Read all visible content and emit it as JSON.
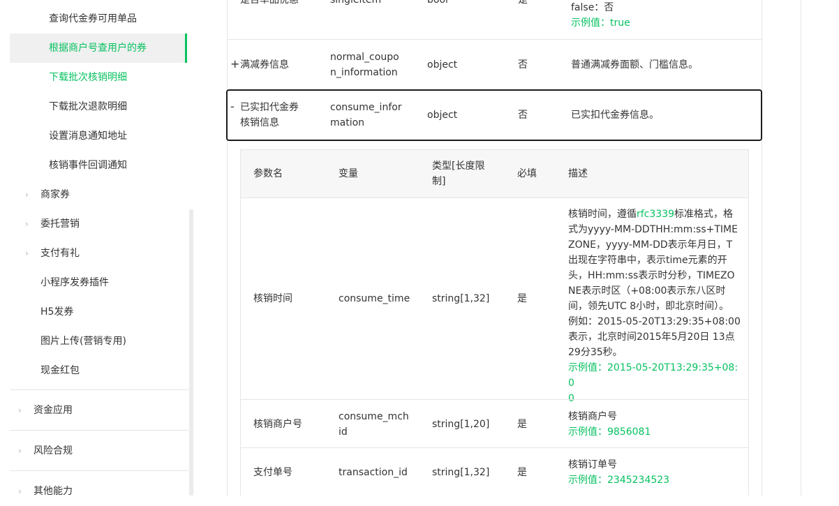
{
  "sidebar": {
    "items": [
      {
        "label": "查询代金券可用单品"
      },
      {
        "label": "根据商户号查用户的券"
      },
      {
        "label": "下载批次核销明细"
      },
      {
        "label": "下载批次退款明细"
      },
      {
        "label": "设置消息通知地址"
      },
      {
        "label": "核销事件回调通知"
      },
      {
        "label": "商家券"
      },
      {
        "label": "委托营销"
      },
      {
        "label": "支付有礼"
      },
      {
        "label": "小程序发券插件"
      },
      {
        "label": "H5发券"
      },
      {
        "label": "图片上传(营销专用)"
      },
      {
        "label": "现金红包"
      },
      {
        "label": "资金应用"
      },
      {
        "label": "风险合规"
      },
      {
        "label": "其他能力"
      }
    ],
    "chevron_icon": "chevron-right-icon"
  },
  "main": {
    "row_top": {
      "name": "是否单品优惠",
      "variable": "singleitem",
      "type": "bool",
      "required": "是",
      "desc_line": "false：否",
      "example": "示例值：true"
    },
    "row_normal": {
      "toggle": "+",
      "name": "满减券信息",
      "variable_l1": "normal_coupo",
      "variable_l2": "n_information",
      "type": "object",
      "required": "否",
      "desc": "普通满减券面额、门槛信息。"
    },
    "row_consume": {
      "toggle": "-",
      "name_l1": "已实扣代金券",
      "name_l2": "核销信息",
      "variable_l1": "consume_infor",
      "variable_l2": "mation",
      "type": "object",
      "required": "否",
      "desc": "已实扣代金券信息。"
    },
    "nested": {
      "headers": {
        "name": "参数名",
        "variable": "变量",
        "type_l1": "类型[长度限",
        "type_l2": "制]",
        "required": "必填",
        "desc": "描述"
      },
      "rows": [
        {
          "name": "核销时间",
          "variable": "consume_time",
          "type": "string[1,32]",
          "required": "是",
          "desc_pre": "核销时间，遵循",
          "desc_link": "rfc3339",
          "desc_l1_post": "标准格式，格",
          "desc_lines": [
            "式为yyyy-MM-DDTHH:mm:ss+TIME",
            "ZONE，yyyy-MM-DD表示年月日，T",
            "出现在字符串中，表示time元素的开",
            "头，HH:mm:ss表示时分秒，TIMEZO",
            "NE表示时区（+08:00表示东八区时",
            "间，领先UTC 8小时，即北京时间）。",
            "例如：2015-05-20T13:29:35+08:00",
            "表示，北京时间2015年5月20日 13点",
            "29分35秒。"
          ],
          "example_l1": "示例值：2015-05-20T13:29:35+08:0",
          "example_l2": "0"
        },
        {
          "name": "核销商户号",
          "variable_l1": "consume_mch",
          "variable_l2": "id",
          "type": "string[1,20]",
          "required": "是",
          "desc": "核销商户号",
          "example": "示例值：9856081"
        },
        {
          "name": "支付单号",
          "variable": "transaction_id",
          "type": "string[1,32]",
          "required": "是",
          "desc": "核销订单号",
          "example": "示例值：2345234523"
        }
      ]
    }
  },
  "colors": {
    "accent": "#07c160",
    "border": "#e5e5e5",
    "header_bg": "#f7f7f7",
    "active_bg": "#f0f0f0"
  }
}
